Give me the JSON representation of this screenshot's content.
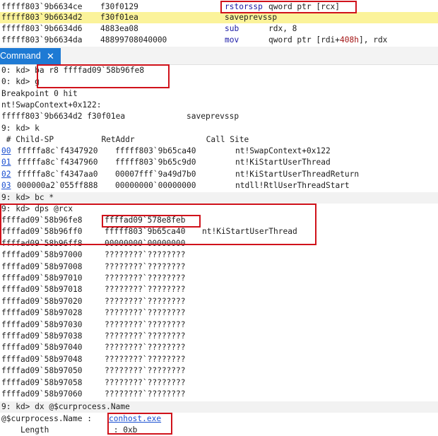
{
  "disassembly": [
    {
      "addr": "fffff803`9b6634ce",
      "bytes": "f30f0129",
      "mnemonic": "rstorssp",
      "operands": "qword ptr [rcx]",
      "highlight": false
    },
    {
      "addr": "fffff803`9b6634d2",
      "bytes": "f30f01ea",
      "mnemonic": "saveprevssp",
      "operands": "",
      "highlight": true
    },
    {
      "addr": "fffff803`9b6634d6",
      "bytes": "4883ea08",
      "mnemonic": "sub",
      "operands": "rdx, 8",
      "highlight": false
    },
    {
      "addr": "fffff803`9b6634da",
      "bytes": "48899708040000",
      "mnemonic": "mov",
      "operands_pre": "qword ptr [rdi+",
      "operands_num": "408h",
      "operands_post": "], rdx",
      "highlight": false
    }
  ],
  "tab": {
    "label": "Command",
    "close_glyph": "✕",
    "accent": "#1e7ad4"
  },
  "cmd": {
    "l1_prompt": "0: kd> ",
    "l1_cmd": "ba r8 ffffad09`58b96fe8",
    "l2_prompt": "0: kd> ",
    "l2_cmd": "g",
    "l3": "Breakpoint 0 hit",
    "l4": "nt!SwapContext+0x122:",
    "l5_addr": "fffff803`9b6634d2 f30f01ea",
    "l5_instr": "saveprevssp",
    "l6": "9: kd> k",
    "stack_header": " # Child-SP          RetAddr               Call Site",
    "stack": [
      {
        "num": "00",
        "sp": "fffffa8c`f4347920",
        "ret": "fffff803`9b65ca40",
        "site": "nt!SwapContext+0x122"
      },
      {
        "num": "01",
        "sp": "fffffa8c`f4347960",
        "ret": "fffff803`9b65c9d0",
        "site": "nt!KiStartUserThread"
      },
      {
        "num": "02",
        "sp": "fffffa8c`f4347aa0",
        "ret": "00007fff`9a49d7b0",
        "site": "nt!KiStartUserThreadReturn"
      },
      {
        "num": "03",
        "sp": "000000a2`055ff888",
        "ret": "00000000`00000000",
        "site": "ntdll!RtlUserThreadStart"
      }
    ],
    "bc": "9: kd> bc *",
    "dps": "9: kd> dps @rcx",
    "dps_rows": [
      {
        "a": "ffffad09`58b96fe8",
        "v": "ffffad09`578e8feb",
        "s": ""
      },
      {
        "a": "ffffad09`58b96ff0",
        "v": "fffff803`9b65ca40",
        "s": "nt!KiStartUserThread"
      },
      {
        "a": "ffffad09`58b96ff8",
        "v": "00000000`00000000",
        "s": ""
      },
      {
        "a": "ffffad09`58b97000",
        "v": "????????`????????",
        "s": ""
      },
      {
        "a": "ffffad09`58b97008",
        "v": "????????`????????",
        "s": ""
      },
      {
        "a": "ffffad09`58b97010",
        "v": "????????`????????",
        "s": ""
      },
      {
        "a": "ffffad09`58b97018",
        "v": "????????`????????",
        "s": ""
      },
      {
        "a": "ffffad09`58b97020",
        "v": "????????`????????",
        "s": ""
      },
      {
        "a": "ffffad09`58b97028",
        "v": "????????`????????",
        "s": ""
      },
      {
        "a": "ffffad09`58b97030",
        "v": "????????`????????",
        "s": ""
      },
      {
        "a": "ffffad09`58b97038",
        "v": "????????`????????",
        "s": ""
      },
      {
        "a": "ffffad09`58b97040",
        "v": "????????`????????",
        "s": ""
      },
      {
        "a": "ffffad09`58b97048",
        "v": "????????`????????",
        "s": ""
      },
      {
        "a": "ffffad09`58b97050",
        "v": "????????`????????",
        "s": ""
      },
      {
        "a": "ffffad09`58b97058",
        "v": "????????`????????",
        "s": ""
      },
      {
        "a": "ffffad09`58b97060",
        "v": "????????`????????",
        "s": ""
      }
    ],
    "dx": "9: kd> dx @$curprocess.Name",
    "dx_res_label": "@$curprocess.Name : ",
    "dx_res_val": "conhost.exe",
    "dx_len_label": "    Length",
    "dx_len_val": " : 0xb"
  },
  "colors": {
    "annotation": "#d0121b",
    "mnemonic": "#1a1aa6",
    "number": "#a31515",
    "highlight": "#fbf39a",
    "link": "#1a4fd1"
  }
}
